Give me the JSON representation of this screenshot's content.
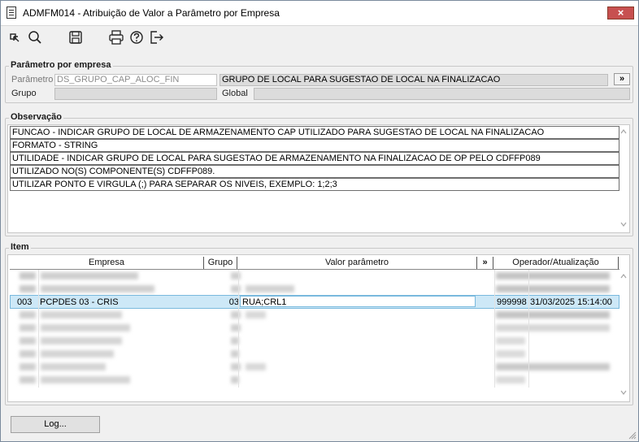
{
  "window": {
    "title": "ADMFM014 - Atribuição de Valor a Parâmetro por Empresa",
    "close_label": "×"
  },
  "toolbar": {
    "buttons": [
      "cursor-icon",
      "search-icon",
      "save-icon",
      "print-icon",
      "help-icon",
      "exit-icon"
    ]
  },
  "parametro_empresa": {
    "legend": "Parâmetro por empresa",
    "parametro_label": "Parâmetro",
    "parametro_value": "DS_GRUPO_CAP_ALOC_FIN",
    "descricao_value": "GRUPO DE LOCAL PARA SUGESTAO DE LOCAL NA FINALIZACAO",
    "expand_label": "»",
    "grupo_label": "Grupo",
    "global_label": "Global"
  },
  "observacao": {
    "legend": "Observação",
    "lines": [
      "FUNCAO - INDICAR GRUPO DE LOCAL DE ARMAZENAMENTO CAP UTILIZADO PARA SUGESTAO DE LOCAL NA FINALIZACAO",
      "FORMATO - STRING",
      "UTILIDADE - INDICAR GRUPO DE LOCAL PARA SUGESTAO DE ARMAZENAMENTO NA FINALIZACAO DE OP PELO CDFFP089",
      "UTILIZADO NO(S) COMPONENTE(S) CDFFP089.",
      "UTILIZAR PONTO E VIRGULA (;) PARA SEPARAR OS NIVEIS, EXEMPLO: 1;2;3"
    ]
  },
  "item": {
    "legend": "Item",
    "columns": {
      "empresa": "Empresa",
      "grupo": "Grupo",
      "valor": "Valor parâmetro",
      "expand": "»",
      "operador": "Operador/Atualização"
    },
    "selected_row": {
      "codigo": "003",
      "empresa": "PCPDES 03 - CRIS",
      "grupo": "03",
      "valor": "RUA;CRL1",
      "operador": "999998",
      "atualizacao": "31/03/2025 15:14:00"
    }
  },
  "footer": {
    "log_label": "Log..."
  },
  "colors": {
    "selection": "#cde8f7",
    "close_button": "#c75050",
    "window_bg": "#f0f0f0"
  }
}
